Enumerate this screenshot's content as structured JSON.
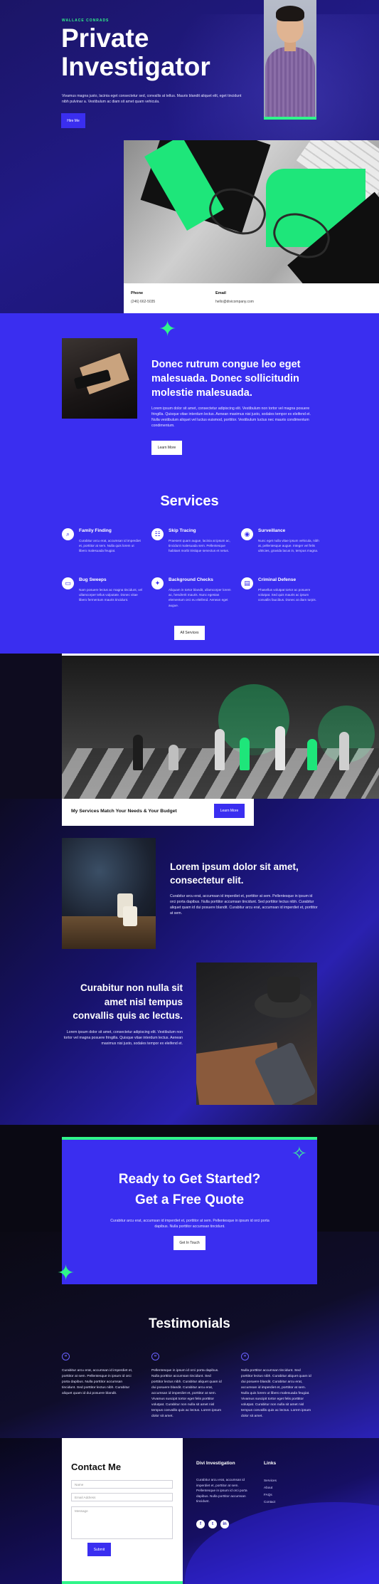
{
  "hero": {
    "eyebrow": "WALLACE CONRADS",
    "title": "Private Investigator",
    "text": "Vivamus magna justo, lacinia eget consectetur sed, convallis at tellus. Mauris blandit aliquet elit, eget tincidunt nibh pulvinar a. Vestibulum ac diam sit amet quam vehicula.",
    "button": "Hire Me"
  },
  "contact_strip": {
    "phone_label": "Phone",
    "phone_value": "(246) 662-5035",
    "email_label": "Email",
    "email_value": "hello@divicompany.com"
  },
  "about": {
    "title": "Donec rutrum congue leo eget malesuada. Donec sollicitudin molestie malesuada.",
    "text": "Lorem ipsum dolor sit amet, consectetur adipiscing elit. Vestibulum non tortor vel magna posuere fringilla. Quisque vitae interdum lectus. Aenean maximus nisi justo, sodales tempor ex eleifend et. Nulla vestibulum aliquet vel luctus euismod, porttitor. Vestibulum luctus nec mauris condimentum condimentum.",
    "button": "Learn More"
  },
  "services": {
    "title": "Services",
    "items": [
      {
        "icon": "magnifier-icon",
        "glyph": "⌕",
        "title": "Family Finding",
        "text": "Curabitur arcu erat, accumsan id imperdiet et, porttitor at sem. Nulla quis lorem ut libero malesuada feugiat."
      },
      {
        "icon": "fingerprint-icon",
        "glyph": "☷",
        "title": "Skip Tracing",
        "text": "Praesent quam augue, lacinia at ipsum ac, tincidunt malesuada sem. Pellentesque habitant morbi tristique senectus et netus."
      },
      {
        "icon": "location-icon",
        "glyph": "◉",
        "title": "Surveillance",
        "text": "Nunc eget nulla vitae ipsum vehicula, nibh at, pellentesque augue. Integer vel felis ultricies, gravida lacus in, tempus magna."
      },
      {
        "icon": "laptop-icon",
        "glyph": "▭",
        "title": "Bug Sweeps",
        "text": "Nam posuere lectus ac magna tincidunt, vel ullamcorper tellus vulputate. Donec vitae libero fermentum mauris tincidunt."
      },
      {
        "icon": "badge-icon",
        "glyph": "✦",
        "title": "Background Checks",
        "text": "Aliquam in tortor blandit, ullamcorper lorem ac, hendrerit mauris. Nunc egestas elementum orci eu eleifend. Aenean eget augue."
      },
      {
        "icon": "document-icon",
        "glyph": "▤",
        "title": "Criminal Defense",
        "text": "Phasellus volutpat tortor ac posuere volutpat. Sed quis mauris ac ipsum convallis faucibus. Donec at diam turpis."
      }
    ],
    "button": "All Services"
  },
  "budget": {
    "text": "My Services Match Your Needs & Your Budget",
    "button": "Learn More"
  },
  "feature1": {
    "title": "Lorem ipsum dolor sit amet, consectetur elit.",
    "text": "Curabitur arcu erat, accumsan id imperdiet et, porttitor at sem. Pellentesque in ipsum id orci porta dapibus. Nulla porttitor accumsan tincidunt. Sed porttitor lectus nibh. Curabitur aliquet quam id dui posuere blandit. Curabitur arcu erat, accumsan id imperdiet et, porttitor at sem."
  },
  "feature2": {
    "title": "Curabitur non nulla sit amet nisl tempus convallis quis ac lectus.",
    "text": "Lorem ipsum dolor sit amet, consectetur adipiscing elit. Vestibulum non tortor vel magna posuere fringilla. Quisque vitae interdum lectus. Aenean maximus nisi justo, sodales tempor ex eleifend et."
  },
  "cta": {
    "title_line1": "Ready to Get Started?",
    "title_line2": "Get a Free Quote",
    "text": "Curabitur arcu erat, accumsan id imperdiet et, porttitor at sem. Pellentesque in ipsum id orci porta dapibus. Nulla porttitor accumsan tincidunt.",
    "button": "Get In Touch"
  },
  "testimonials": {
    "title": "Testimonials",
    "items": [
      {
        "text": "Curabitur arcu erat, accumsan id imperdiet et, porttitor at sem. Pellentesque in ipsum id orci porta dapibus. Nulla porttitor accumsan tincidunt. Sed porttitor lectus nibh. Curabitur aliquet quam id dui posuere blandit."
      },
      {
        "text": "Pellentesque in ipsum id orci porta dapibus. Nulla porttitor accumsan tincidunt. Sed porttitor lectus nibh. Curabitur aliquet quam id dui posuere blandit. Curabitur arcu erat, accumsan id imperdiet et, porttitor at sem. Vivamus suscipit tortor eget felis porttitor volutpat. Curabitur non nulla sit amet nisl tempus convallis quis ac lectus. Lorem ipsum dolor sit amet."
      },
      {
        "text": "Nulla porttitor accumsan tincidunt. Sed porttitor lectus nibh. Curabitur aliquet quam id dui posuere blandit. Curabitur arcu erat, accumsan id imperdiet et, porttitor at sem. Nulla quis lorem ut libero malesuada feugiat. Vivamus suscipit tortor eget felis porttitor volutpat. Curabitur non nulla sit amet nisl tempus convallis quis ac lectus. Lorem ipsum dolor sit amet."
      }
    ]
  },
  "contact_form": {
    "title": "Contact Me",
    "name_placeholder": "Name",
    "email_placeholder": "Email Address",
    "message_placeholder": "Message",
    "submit": "Submit"
  },
  "footer": {
    "company_title": "Divi Investigation",
    "company_text": "Curabitur arcu erat, accumsan id imperdiet et, porttitor at sem. Pellentesque in ipsum id orci porta dapibus. Nulla porttitor accumsan tincidunt.",
    "links_title": "Links",
    "links": [
      "Services",
      "About",
      "FAQs",
      "Contact"
    ],
    "social": [
      {
        "icon": "facebook-icon",
        "glyph": "f"
      },
      {
        "icon": "twitter-icon",
        "glyph": "t"
      },
      {
        "icon": "instagram-icon",
        "glyph": "in"
      }
    ]
  },
  "colors": {
    "accent_blue": "#3a2ef0",
    "accent_green": "#30f58a",
    "dark_navy": "#0e0c1f"
  }
}
